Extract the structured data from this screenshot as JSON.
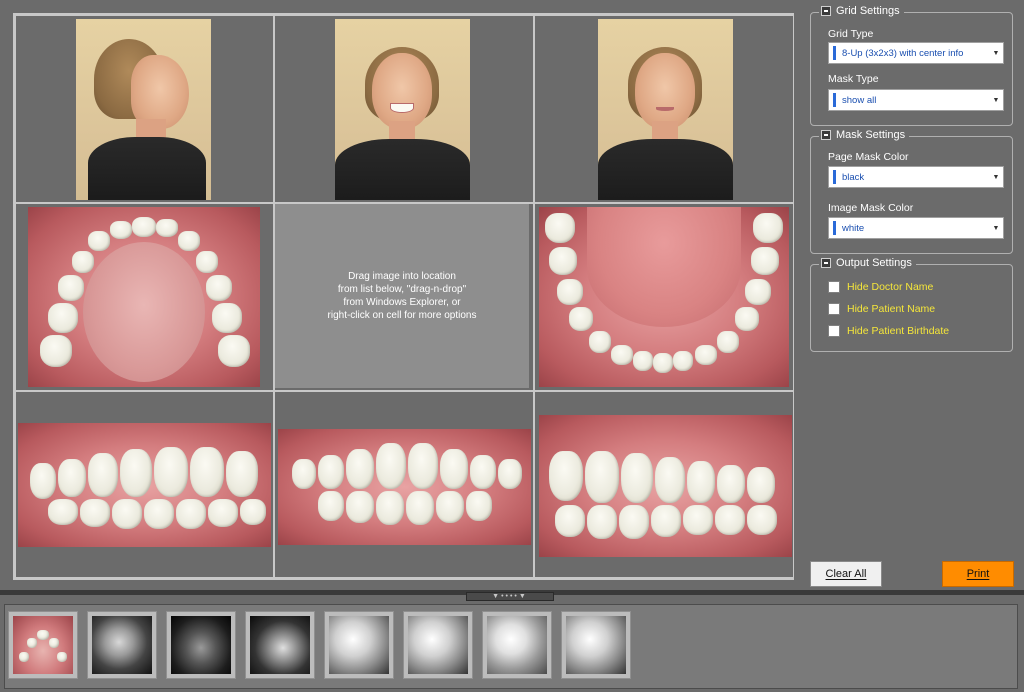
{
  "placeholder": {
    "line1": "Drag image into location",
    "line2": "from list below, \"drag-n-drop\"",
    "line3": "from Windows Explorer, or",
    "line4": "right-click on cell for more options"
  },
  "grid_settings": {
    "title": "Grid Settings",
    "grid_type_label": "Grid Type",
    "grid_type_value": "8-Up (3x2x3) with center info",
    "mask_type_label": "Mask Type",
    "mask_type_value": "show all"
  },
  "mask_settings": {
    "title": "Mask Settings",
    "page_mask_label": "Page Mask Color",
    "page_mask_value": "black",
    "image_mask_label": "Image Mask Color",
    "image_mask_value": "white"
  },
  "output_settings": {
    "title": "Output Settings",
    "options": [
      {
        "label": "Hide Doctor Name",
        "checked": false
      },
      {
        "label": "Hide Patient Name",
        "checked": false
      },
      {
        "label": "Hide Patient Birthdate",
        "checked": false
      }
    ]
  },
  "buttons": {
    "clear_all": "Clear All",
    "print": "Print"
  },
  "thumbnails": [
    {
      "kind": "upper-occlusal-photo"
    },
    {
      "kind": "panoramic-xray"
    },
    {
      "kind": "ct-axial-xray"
    },
    {
      "kind": "3d-ct-xray"
    },
    {
      "kind": "cephalometric-xray"
    },
    {
      "kind": "cephalometric-xray"
    },
    {
      "kind": "cephalometric-xray"
    },
    {
      "kind": "cephalometric-xray"
    }
  ],
  "colors": {
    "background": "#6b6b6b",
    "print_button": "#ff8c00",
    "option_text": "#f5e63a",
    "combo_text": "#1a4fb0"
  }
}
